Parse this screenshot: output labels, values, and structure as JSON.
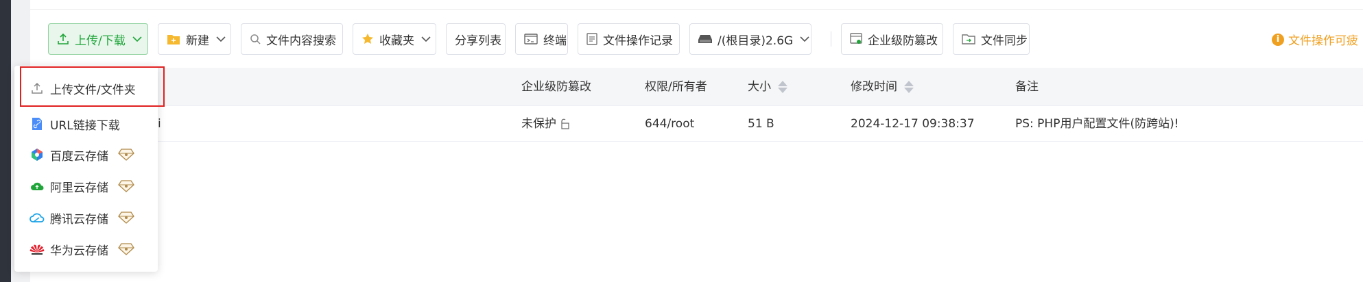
{
  "toolbar": {
    "upload_download": "上传/下载",
    "new": "新建",
    "content_search": "文件内容搜索",
    "favorites": "收藏夹",
    "share_list": "分享列表",
    "terminal": "终端",
    "file_op_log": "文件操作记录",
    "disk": "/(根目录)2.6G",
    "tamper_proof": "企业级防篡改",
    "file_sync": "文件同步"
  },
  "notice": {
    "icon": "info-icon",
    "text": "文件操作可疲"
  },
  "table": {
    "headers": {
      "tamper": "企业级防篡改",
      "perm_owner": "权限/所有者",
      "size": "大小",
      "mtime": "修改时间",
      "remark": "备注"
    },
    "rows": [
      {
        "name_fragment": "i",
        "tamper": "未保护",
        "perm_owner": "644/root",
        "size": "51 B",
        "mtime": "2024-12-17 09:38:37",
        "remark": "PS: PHP用户配置文件(防跨站)!"
      }
    ]
  },
  "dropdown": {
    "items": [
      {
        "label": "上传文件/文件夹",
        "icon": "upload-icon"
      },
      {
        "label": "URL链接下载",
        "icon": "link-file-icon"
      },
      {
        "label": "百度云存储",
        "icon": "baidu-cloud-icon",
        "pro": true
      },
      {
        "label": "阿里云存储",
        "icon": "aliyun-icon",
        "pro": true
      },
      {
        "label": "腾讯云存储",
        "icon": "tencent-cloud-icon",
        "pro": true
      },
      {
        "label": "华为云存储",
        "icon": "huawei-icon",
        "pro": true
      }
    ]
  },
  "colors": {
    "accent": "#20a53a",
    "warn": "#f0a020",
    "highlight": "#e02020"
  }
}
